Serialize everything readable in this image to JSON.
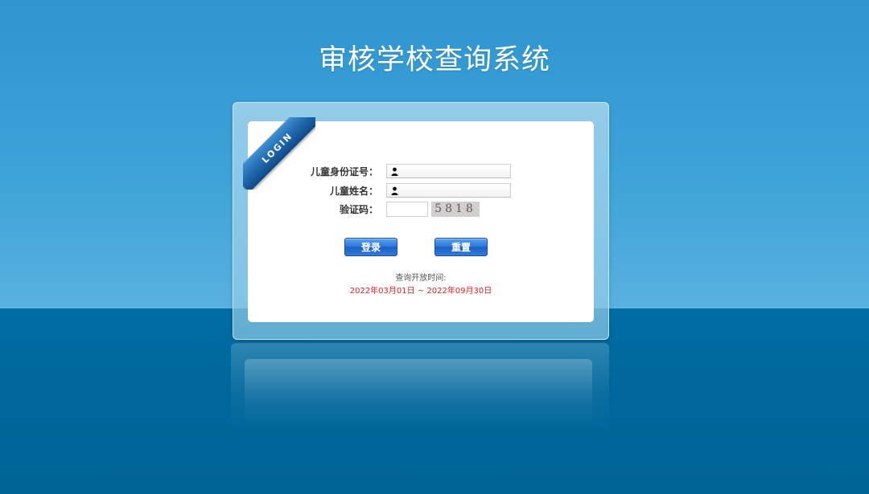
{
  "page": {
    "title": "审核学校查询系统"
  },
  "login": {
    "ribbon_text": "LOGIN",
    "fields": {
      "id_label": "儿童身份证号：",
      "id_value": "",
      "name_label": "儿童姓名：",
      "name_value": "",
      "captcha_label": "验证码：",
      "captcha_value": "",
      "captcha_code": "5818"
    },
    "buttons": {
      "login_label": "登录",
      "reset_label": "重置"
    },
    "hint": {
      "label": "查询开放时间:",
      "range": "2022年03月01日 ~ 2022年09月30日"
    }
  },
  "colors": {
    "sky": "#2f95cf",
    "floor": "#006ea3",
    "button": "#2b74d6",
    "hint_range": "#e02020"
  }
}
